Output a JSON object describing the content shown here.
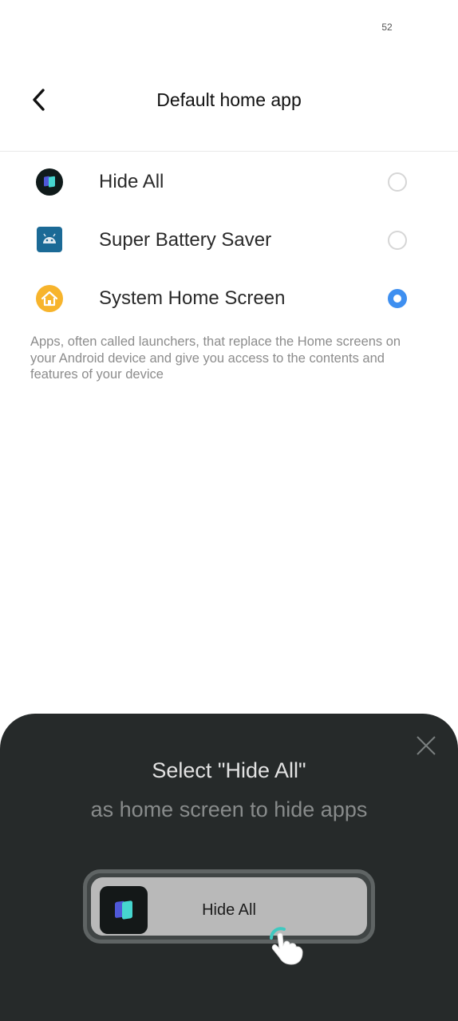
{
  "status_bar": {
    "time": "52"
  },
  "header": {
    "title": "Default home app",
    "back_icon": "back-arrow-icon"
  },
  "apps": [
    {
      "label": "Hide All",
      "icon": "hide-all-app-icon",
      "selected": false
    },
    {
      "label": "Super Battery Saver",
      "icon": "android-robot-icon",
      "selected": false
    },
    {
      "label": "System Home Screen",
      "icon": "house-icon",
      "selected": true
    }
  ],
  "description": "Apps, often called launchers, that replace the Home screens on your Android device and give you access to the contents and features of your device",
  "sheet": {
    "title": "Select \"Hide All\"",
    "subtitle": "as home screen to hide apps",
    "demo_label": "Hide All",
    "close_icon": "close-icon",
    "hand_icon": "tap-hand-icon"
  },
  "colors": {
    "accent": "#3e8ff0",
    "sheet_background": "#262a2a",
    "description_text": "#8c8c8c"
  }
}
